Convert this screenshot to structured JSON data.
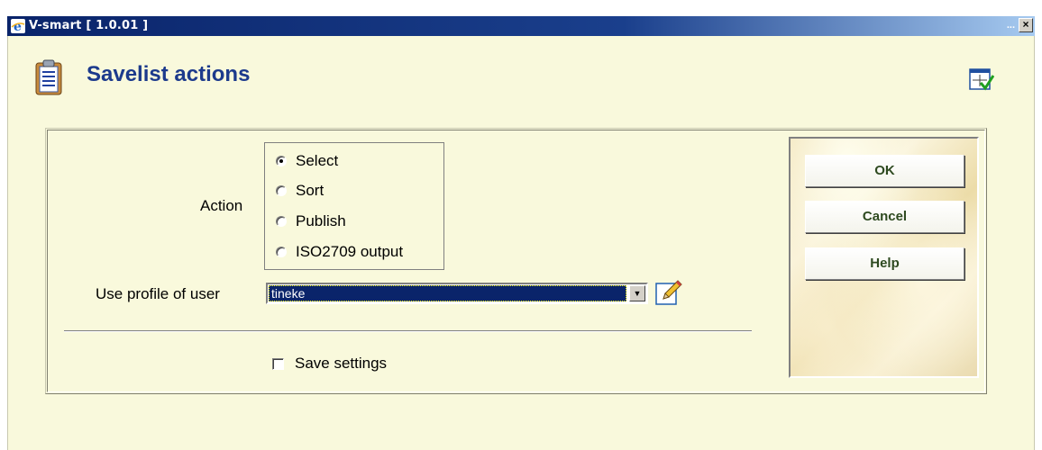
{
  "window": {
    "title": "V-smart [ 1.0.01 ]",
    "minimize_label": "...",
    "close_label": "×"
  },
  "header": {
    "title": "Savelist actions"
  },
  "form": {
    "action_label": "Action",
    "action_options": [
      "Select",
      "Sort",
      "Publish",
      "ISO2709 output"
    ],
    "action_selected": "Select",
    "profile_label": "Use profile of user",
    "profile_value": "tineke",
    "save_settings_label": "Save settings",
    "save_settings_checked": false
  },
  "buttons": {
    "ok": "OK",
    "cancel": "Cancel",
    "help": "Help"
  },
  "colors": {
    "window_bg": "#f9f9dc",
    "title_blue": "#1c3a8c",
    "button_text": "#2e4a20",
    "select_highlight": "#0a246a"
  },
  "icons": {
    "app": "ie-globe-icon",
    "header": "clipboard-list-icon",
    "tool": "window-check-icon",
    "edit": "pencil-icon"
  }
}
